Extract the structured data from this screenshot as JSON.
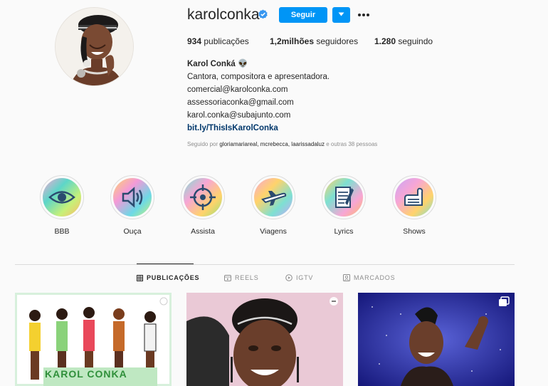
{
  "profile": {
    "username": "karolconka",
    "follow_label": "Seguir",
    "stats": {
      "posts": "934",
      "posts_label": " publicações",
      "followers": "1,2milhões",
      "followers_label": " seguidores",
      "following": "1.280",
      "following_label": " seguindo"
    },
    "bio": {
      "name": "Karol Conká",
      "emoji": "👽",
      "line1": "Cantora, compositora e apresentadora.",
      "line2": "comercial@karolconka.com",
      "line3": "assessoriaconka@gmail.com",
      "line4": "karol.conka@subajunto.com",
      "link": "bit.ly/ThisIsKarolConka"
    },
    "followed_by": {
      "prefix": "Seguido por ",
      "names": "gloriamariareal, mcrebecca, laarissadaluz",
      "suffix": " e outras 38 pessoas"
    }
  },
  "highlights": [
    {
      "label": "BBB",
      "icon": "eye-icon"
    },
    {
      "label": "Ouça",
      "icon": "speaker-icon"
    },
    {
      "label": "Assista",
      "icon": "target-icon"
    },
    {
      "label": "Viagens",
      "icon": "airplane-icon"
    },
    {
      "label": "Lyrics",
      "icon": "notepad-icon"
    },
    {
      "label": "Shows",
      "icon": "hand-icon"
    }
  ],
  "tabs": [
    {
      "label": "PUBLICAÇÕES",
      "icon": "grid-icon",
      "active": true
    },
    {
      "label": "REELS",
      "icon": "reels-icon",
      "active": false
    },
    {
      "label": "IGTV",
      "icon": "igtv-icon",
      "active": false
    },
    {
      "label": "MARCADOS",
      "icon": "tag-icon",
      "active": false
    }
  ],
  "posts": [
    {
      "title": "KAROL CONKA"
    },
    {
      "title": ""
    },
    {
      "title": ""
    }
  ],
  "colors": {
    "accent": "#0095f6",
    "link": "#00376b",
    "muted": "#8e8e8e"
  }
}
